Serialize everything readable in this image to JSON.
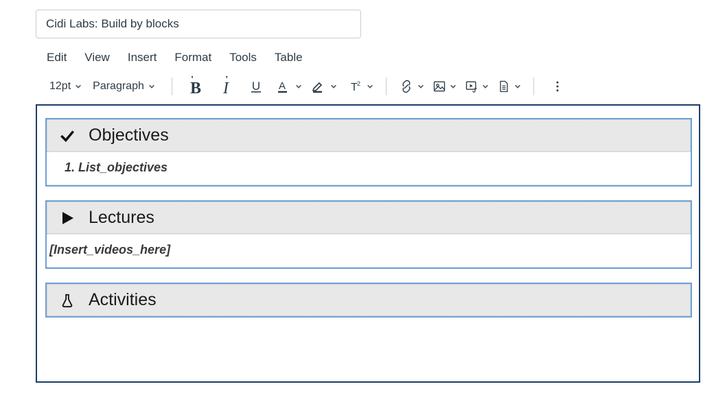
{
  "title_field": {
    "value": "Cidi Labs: Build by blocks"
  },
  "menubar": {
    "edit": "Edit",
    "view": "View",
    "insert": "Insert",
    "format": "Format",
    "tools": "Tools",
    "table": "Table"
  },
  "toolbar": {
    "font_size": "12pt",
    "block_format": "Paragraph"
  },
  "blocks": {
    "objectives": {
      "heading": "Objectives",
      "list_item_1": "List_objectives"
    },
    "lectures": {
      "heading": "Lectures",
      "placeholder": "[Insert_videos_here]"
    },
    "activities": {
      "heading": "Activities"
    }
  }
}
